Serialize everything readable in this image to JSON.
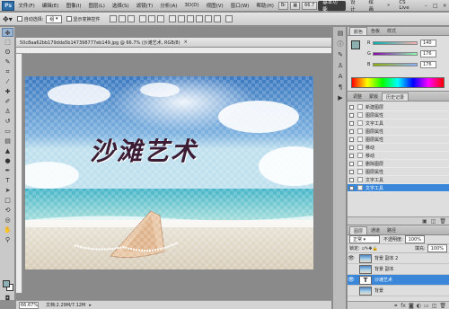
{
  "menubar": {
    "logo": "Ps",
    "items": [
      "文件(F)",
      "编辑(E)",
      "图像(I)",
      "图层(L)",
      "选择(S)",
      "滤镜(T)",
      "分析(A)",
      "3D(D)",
      "视图(V)",
      "窗口(W)",
      "帮助(H)"
    ],
    "zoom": "66.7",
    "workspaces": [
      "基本功能",
      "设计",
      "绘画"
    ],
    "cs_live": "CS Live"
  },
  "optionsbar": {
    "auto_select_label": "自动选择:",
    "auto_select_value": "组",
    "show_transform_label": "显示变换控件"
  },
  "document": {
    "tab_title": "50c8aa62bb179dda5b147398777eb149.jpg @ 66.7% (沙滩艺术, RGB/8)",
    "canvas_text": "沙滩艺术",
    "zoom": "66.67%",
    "doc_info": "文档:2.29M/7.12M"
  },
  "color_panel": {
    "tabs": [
      "颜色",
      "色板",
      "样式"
    ],
    "channels": [
      {
        "label": "R",
        "value": "140"
      },
      {
        "label": "G",
        "value": "176"
      },
      {
        "label": "B",
        "value": "176"
      }
    ],
    "foreground_color": "#8cb0b0"
  },
  "history_panel": {
    "tabs": [
      "调整",
      "蒙版",
      "历史记录"
    ],
    "items": [
      "新建图层",
      "图层属性",
      "文字工具",
      "图层属性",
      "图层属性",
      "移动",
      "移动",
      "删除图层",
      "图层属性",
      "文字工具",
      "文字工具"
    ]
  },
  "layers_panel": {
    "tabs": [
      "图层",
      "通道",
      "路径"
    ],
    "blend_mode": "正常",
    "opacity_label": "不透明度:",
    "opacity": "100%",
    "lock_label": "锁定:",
    "fill_label": "填充:",
    "fill": "100%",
    "layers": [
      {
        "name": "背景 副本 2",
        "type": "image",
        "visible": true
      },
      {
        "name": "背景 副本",
        "type": "image",
        "visible": false
      },
      {
        "name": "沙滩艺术",
        "type": "text",
        "visible": true
      },
      {
        "name": "背景",
        "type": "image",
        "visible": false
      }
    ]
  }
}
